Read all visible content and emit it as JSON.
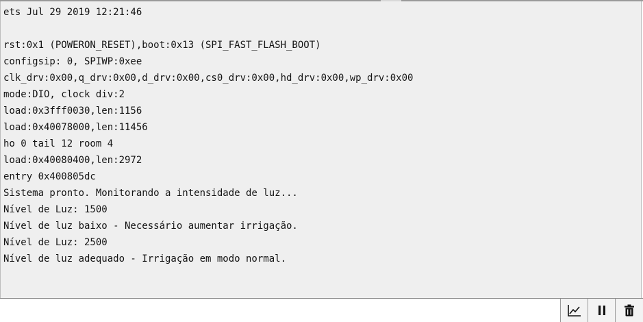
{
  "serial_monitor": {
    "lines": [
      "ets Jul 29 2019 12:21:46",
      "",
      "rst:0x1 (POWERON_RESET),boot:0x13 (SPI_FAST_FLASH_BOOT)",
      "configsip: 0, SPIWP:0xee",
      "clk_drv:0x00,q_drv:0x00,d_drv:0x00,cs0_drv:0x00,hd_drv:0x00,wp_drv:0x00",
      "mode:DIO, clock div:2",
      "load:0x3fff0030,len:1156",
      "load:0x40078000,len:11456",
      "ho 0 tail 12 room 4",
      "load:0x40080400,len:2972",
      "entry 0x400805dc",
      "Sistema pronto. Monitorando a intensidade de luz...",
      "Nível de Luz: 1500",
      "Nível de luz baixo - Necessário aumentar irrigação.",
      "Nível de Luz: 2500",
      "Nível de luz adequado - Irrigação em modo normal."
    ]
  },
  "input_bar": {
    "value": "",
    "placeholder": ""
  },
  "toolbar": {
    "buttons": [
      {
        "icon": "chart-icon"
      },
      {
        "icon": "pause-icon"
      },
      {
        "icon": "trash-icon"
      }
    ]
  },
  "colors": {
    "output_background": "#efefef",
    "text": "#141414",
    "toolbar_background": "#f3f3f3"
  }
}
